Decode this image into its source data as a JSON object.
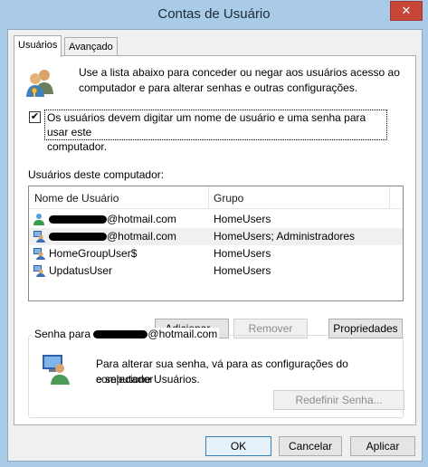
{
  "window": {
    "title": "Contas de Usuário",
    "close_label": "✕"
  },
  "tabs": [
    {
      "label": "Usuários"
    },
    {
      "label": "Avançado"
    }
  ],
  "intro": {
    "line1": "Use a lista abaixo para conceder ou negar aos usuários acesso ao",
    "line2": "computador e para alterar senhas e outras configurações."
  },
  "require_login": {
    "checked": true,
    "mark": "✔",
    "line1": "Os usuários devem digitar um nome de usuário e uma senha para usar este",
    "line2": "computador."
  },
  "users_section_label": "Usuários deste computador:",
  "users_table": {
    "columns": [
      "Nome de Usuário",
      "Grupo"
    ],
    "rows": [
      {
        "name_suffix": "@hotmail.com",
        "group": "HomeUsers",
        "redacted": true,
        "icon": "user-account-icon"
      },
      {
        "name_suffix": "@hotmail.com",
        "group": "HomeUsers; Administradores",
        "redacted": true,
        "icon": "admin-account-icon",
        "selected": true
      },
      {
        "name_suffix": "HomeGroupUser$",
        "group": "HomeUsers",
        "redacted": false,
        "icon": "admin-account-icon"
      },
      {
        "name_suffix": "UpdatusUser",
        "group": "HomeUsers",
        "redacted": false,
        "icon": "admin-account-icon"
      }
    ]
  },
  "list_buttons": {
    "add": "Adicionar...",
    "remove": "Remover",
    "properties": "Propriedades"
  },
  "password_group": {
    "label_prefix": "Senha para",
    "label_suffix": "@hotmail.com",
    "text_line1": "Para alterar sua senha, vá para as configurações do computador",
    "text_line2": "e selecione Usuários.",
    "reset_button": "Redefinir Senha..."
  },
  "dialog_buttons": {
    "ok": "OK",
    "cancel": "Cancelar",
    "apply": "Aplicar"
  },
  "colors": {
    "frame": "#a9cbe8",
    "close": "#c7463a",
    "default_button": "#3c7fb1"
  }
}
